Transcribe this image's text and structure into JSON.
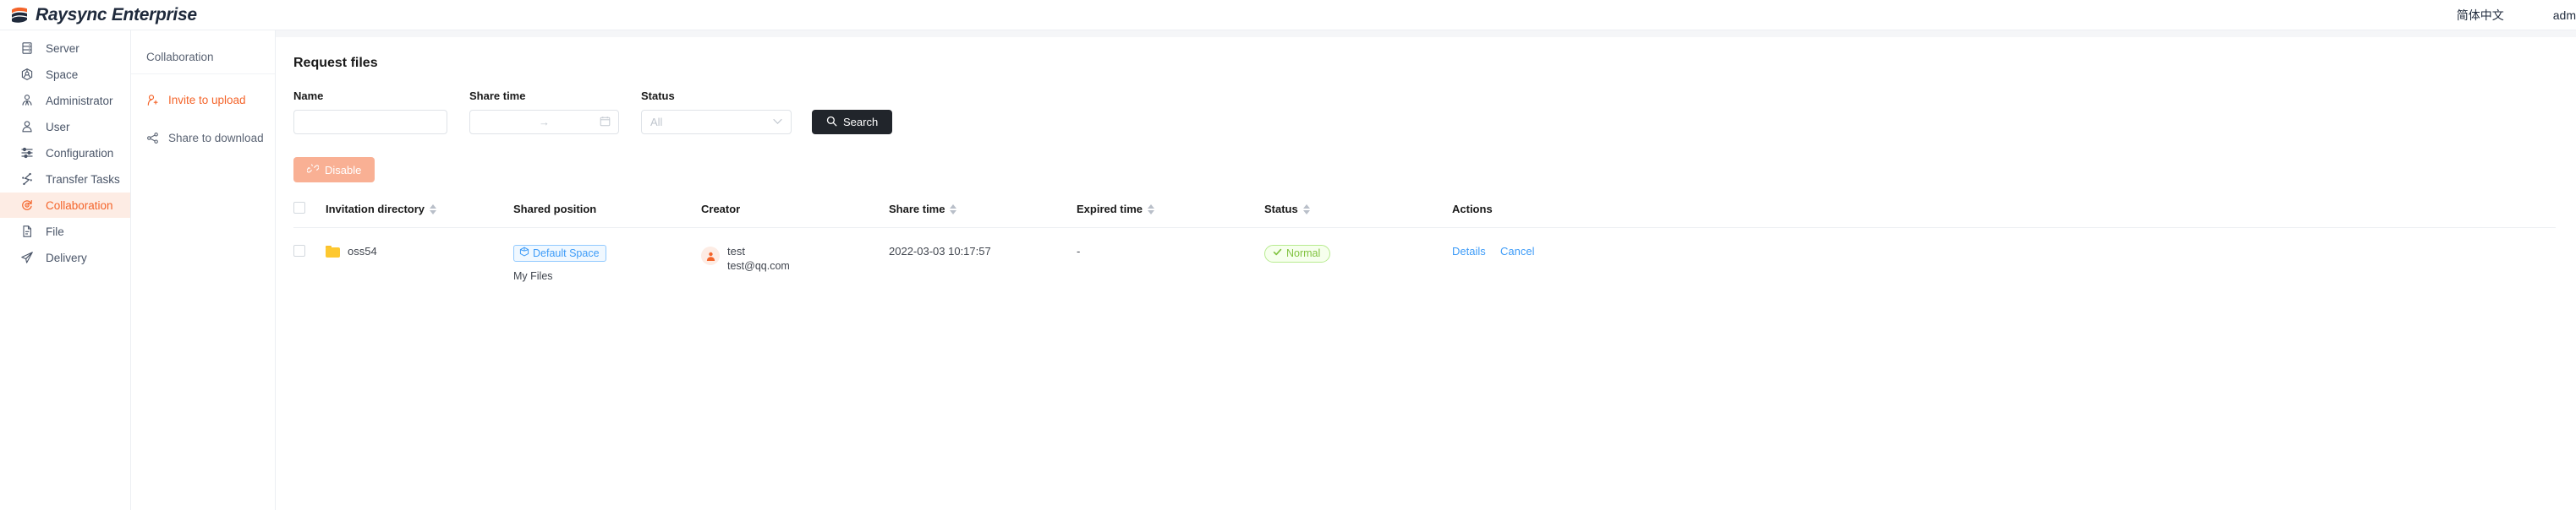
{
  "topbar": {
    "brand": "Raysync Enterprise",
    "logo_icon": "raysync-stack-icon",
    "language": "简体中文",
    "user": "adm"
  },
  "sidebar": {
    "items": [
      {
        "label": "Server",
        "icon": "server-icon",
        "active": false
      },
      {
        "label": "Space",
        "icon": "cube-node-icon",
        "active": false
      },
      {
        "label": "Administrator",
        "icon": "admin-user-icon",
        "active": false
      },
      {
        "label": "User",
        "icon": "user-icon",
        "active": false
      },
      {
        "label": "Configuration",
        "icon": "sliders-icon",
        "active": false
      },
      {
        "label": "Transfer Tasks",
        "icon": "transfer-bolt-icon",
        "active": false
      },
      {
        "label": "Collaboration",
        "icon": "sync-circle-icon",
        "active": true
      },
      {
        "label": "File",
        "icon": "document-icon",
        "active": false
      },
      {
        "label": "Delivery",
        "icon": "paper-plane-icon",
        "active": false
      }
    ],
    "active_color": "#f4642a",
    "active_background": "#fdece4"
  },
  "subpanel": {
    "title": "Collaboration",
    "items": [
      {
        "label": "Invite to upload",
        "icon": "user-plus-icon",
        "active": true
      },
      {
        "label": "Share to download",
        "icon": "share-icon",
        "active": false
      }
    ]
  },
  "main": {
    "page_title": "Request files",
    "filters": {
      "name": {
        "label": "Name",
        "value": "",
        "placeholder": ""
      },
      "share_time": {
        "label": "Share time",
        "value": "",
        "separator": "→",
        "icon": "calendar-icon"
      },
      "status": {
        "label": "Status",
        "value": "",
        "placeholder": "All",
        "icon": "chevron-down-icon"
      },
      "search_button": {
        "label": "Search",
        "icon": "search-icon"
      }
    },
    "toolbar": {
      "disable_button": {
        "label": "Disable",
        "icon": "broken-link-icon",
        "disabled": true
      }
    },
    "table": {
      "columns": [
        {
          "key": "checkbox",
          "label": "",
          "sortable": false
        },
        {
          "key": "dir",
          "label": "Invitation directory",
          "sortable": true
        },
        {
          "key": "pos",
          "label": "Shared position",
          "sortable": false
        },
        {
          "key": "creator",
          "label": "Creator",
          "sortable": false
        },
        {
          "key": "share",
          "label": "Share time",
          "sortable": true
        },
        {
          "key": "expired",
          "label": "Expired time",
          "sortable": true
        },
        {
          "key": "status",
          "label": "Status",
          "sortable": true
        },
        {
          "key": "actions",
          "label": "Actions",
          "sortable": false
        }
      ],
      "rows": [
        {
          "selected": false,
          "directory": "oss54",
          "directory_icon": "folder-icon",
          "space_tag": "Default Space",
          "space_tag_icon": "cube-icon",
          "shared_path": "My Files",
          "creator_name": "test",
          "creator_email": "test@qq.com",
          "creator_avatar_icon": "user-avatar-icon",
          "share_time": "2022-03-03 10:17:57",
          "expired_time": "-",
          "status": "Normal",
          "status_icon": "check-icon",
          "actions": {
            "details": "Details",
            "cancel": "Cancel"
          }
        }
      ]
    }
  },
  "colors": {
    "brand_orange": "#f4642a",
    "link_blue": "#3e9cf8",
    "status_green": "#82c341",
    "dark_button": "#21252b",
    "folder_yellow": "#fdc830"
  }
}
